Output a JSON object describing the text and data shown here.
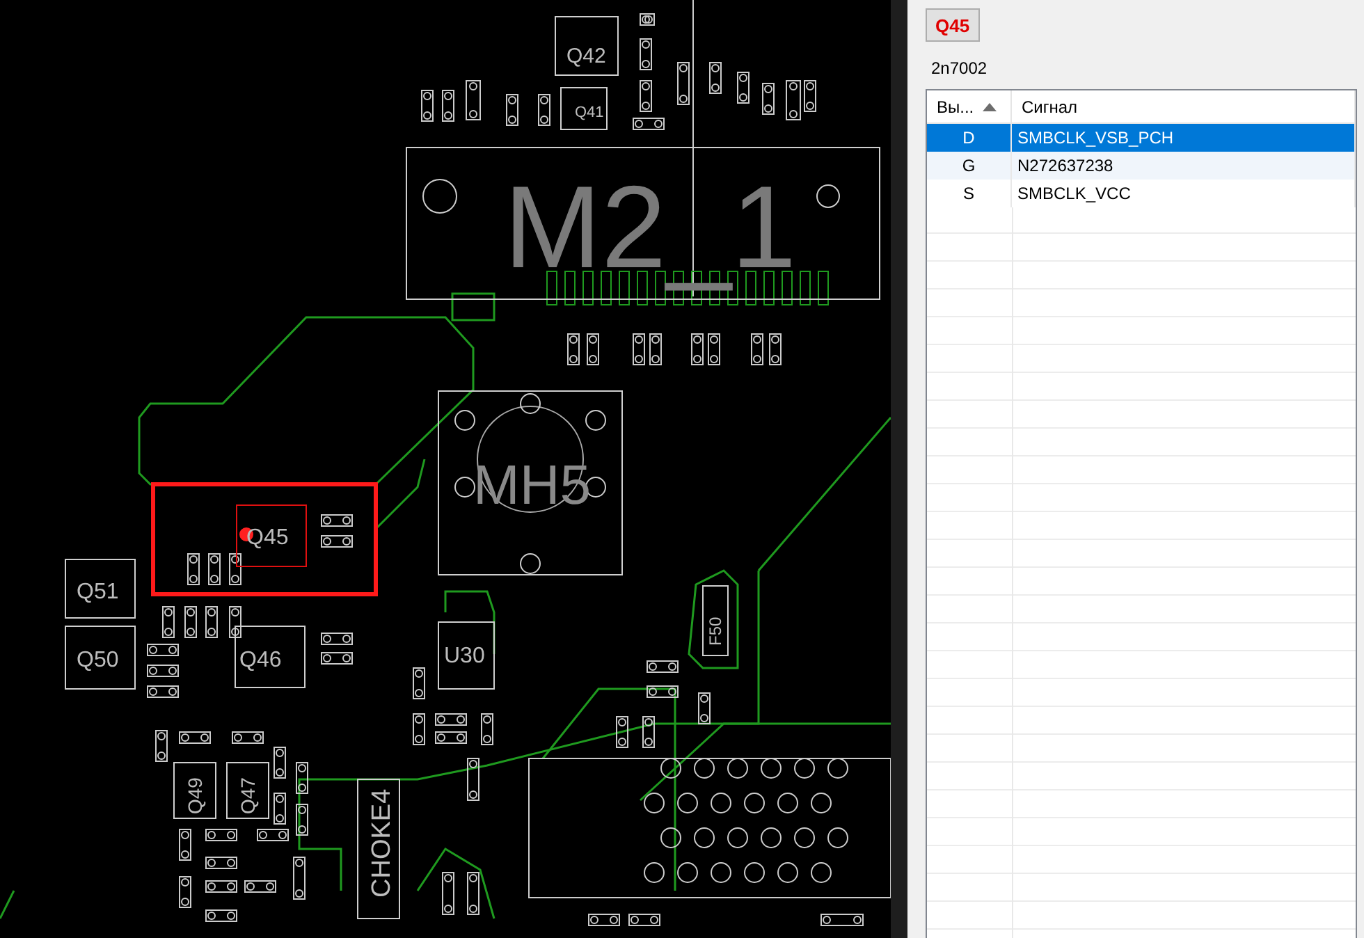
{
  "board": {
    "components": [
      {
        "label": "Q42",
        "selected": false
      },
      {
        "label": "Q41",
        "selected": false
      },
      {
        "label": "M2_1",
        "selected": false
      },
      {
        "label": "MH5",
        "selected": false
      },
      {
        "label": "Q45",
        "selected": true
      },
      {
        "label": "Q51",
        "selected": false
      },
      {
        "label": "Q50",
        "selected": false
      },
      {
        "label": "Q46",
        "selected": false
      },
      {
        "label": "U30",
        "selected": false
      },
      {
        "label": "F50",
        "selected": false
      },
      {
        "label": "Q49",
        "selected": false
      },
      {
        "label": "Q47",
        "selected": false
      },
      {
        "label": "CHOKE4",
        "selected": false
      }
    ]
  },
  "panel": {
    "part_button": "Q45",
    "part_type": "2n7002",
    "table": {
      "columns": [
        "Вы...",
        "Сигнал"
      ],
      "rows": [
        {
          "pin": "D",
          "signal": "SMBCLK_VSB_PCH",
          "selected": true
        },
        {
          "pin": "G",
          "signal": "N272637238",
          "selected": false
        },
        {
          "pin": "S",
          "signal": "SMBCLK_VCC",
          "selected": false
        }
      ]
    }
  }
}
